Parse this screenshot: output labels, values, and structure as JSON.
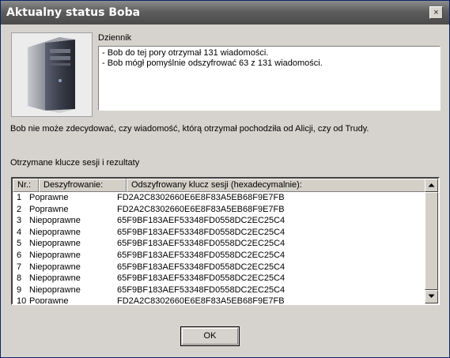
{
  "window": {
    "title": "Aktualny status Boba"
  },
  "dziennik": {
    "label": "Dziennik",
    "lines": [
      "- Bob do tej pory otrzymał 131 wiadomości.",
      "- Bob mógł pomyślnie odszyfrować 63 z 131 wiadomości."
    ]
  },
  "status_text": "Bob nie może zdecydować, czy wiadomość, którą otrzymał pochodziła od Alicji, czy od Trudy.",
  "keys": {
    "label": "Otrzymane klucze sesji i rezultaty",
    "columns": [
      "Nr.:",
      "Deszyfrowanie:",
      "Odszyfrowany klucz sesji (hexadecymalnie):"
    ],
    "rows": [
      {
        "nr": "1",
        "result": "Poprawne",
        "key": "FD2A2C8302660E6E8F83A5EB68F9E7FB"
      },
      {
        "nr": "2",
        "result": "Poprawne",
        "key": "FD2A2C8302660E6E8F83A5EB68F9E7FB"
      },
      {
        "nr": "3",
        "result": "Niepoprawne",
        "key": "65F9BF183AEF53348FD0558DC2EC25C4"
      },
      {
        "nr": "4",
        "result": "Niepoprawne",
        "key": "65F9BF183AEF53348FD0558DC2EC25C4"
      },
      {
        "nr": "5",
        "result": "Niepoprawne",
        "key": "65F9BF183AEF53348FD0558DC2EC25C4"
      },
      {
        "nr": "6",
        "result": "Niepoprawne",
        "key": "65F9BF183AEF53348FD0558DC2EC25C4"
      },
      {
        "nr": "7",
        "result": "Niepoprawne",
        "key": "65F9BF183AEF53348FD0558DC2EC25C4"
      },
      {
        "nr": "8",
        "result": "Niepoprawne",
        "key": "65F9BF183AEF53348FD0558DC2EC25C4"
      },
      {
        "nr": "9",
        "result": "Niepoprawne",
        "key": "65F9BF183AEF53348FD0558DC2EC25C4"
      },
      {
        "nr": "10",
        "result": "Poprawne",
        "key": "FD2A2C8302660E6E8F83A5EB68F9E7FB"
      }
    ]
  },
  "buttons": {
    "ok": "OK",
    "close": "×"
  },
  "icons": {
    "close": "close-icon",
    "scroll_up": "scroll-up-arrow-icon",
    "scroll_down": "scroll-down-arrow-icon",
    "computer": "computer-tower-icon"
  }
}
